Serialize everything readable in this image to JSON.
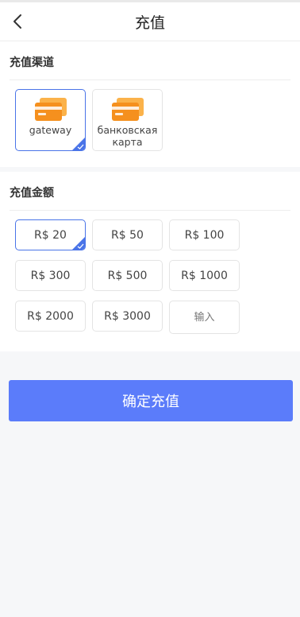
{
  "header": {
    "title": "充值",
    "back_icon": "chevron-left-icon"
  },
  "channel_section": {
    "title": "充值渠道",
    "items": [
      {
        "label": "gateway",
        "selected": true,
        "icon": "card-icon"
      },
      {
        "label": "банковская карта",
        "selected": false,
        "icon": "card-icon"
      }
    ]
  },
  "amount_section": {
    "title": "充值金额",
    "items": [
      {
        "label": "R$ 20",
        "selected": true
      },
      {
        "label": "R$ 50",
        "selected": false
      },
      {
        "label": "R$ 100",
        "selected": false
      },
      {
        "label": "R$ 300",
        "selected": false
      },
      {
        "label": "R$ 500",
        "selected": false
      },
      {
        "label": "R$ 1000",
        "selected": false
      },
      {
        "label": "R$ 2000",
        "selected": false
      },
      {
        "label": "R$ 3000",
        "selected": false
      }
    ],
    "input_placeholder": "输入",
    "input_value": ""
  },
  "confirm_label": "确定充值",
  "colors": {
    "accent": "#5b7cfa",
    "selected_border": "#4a74e8",
    "card_orange": "#f5901e",
    "background": "#f6f7f9"
  }
}
